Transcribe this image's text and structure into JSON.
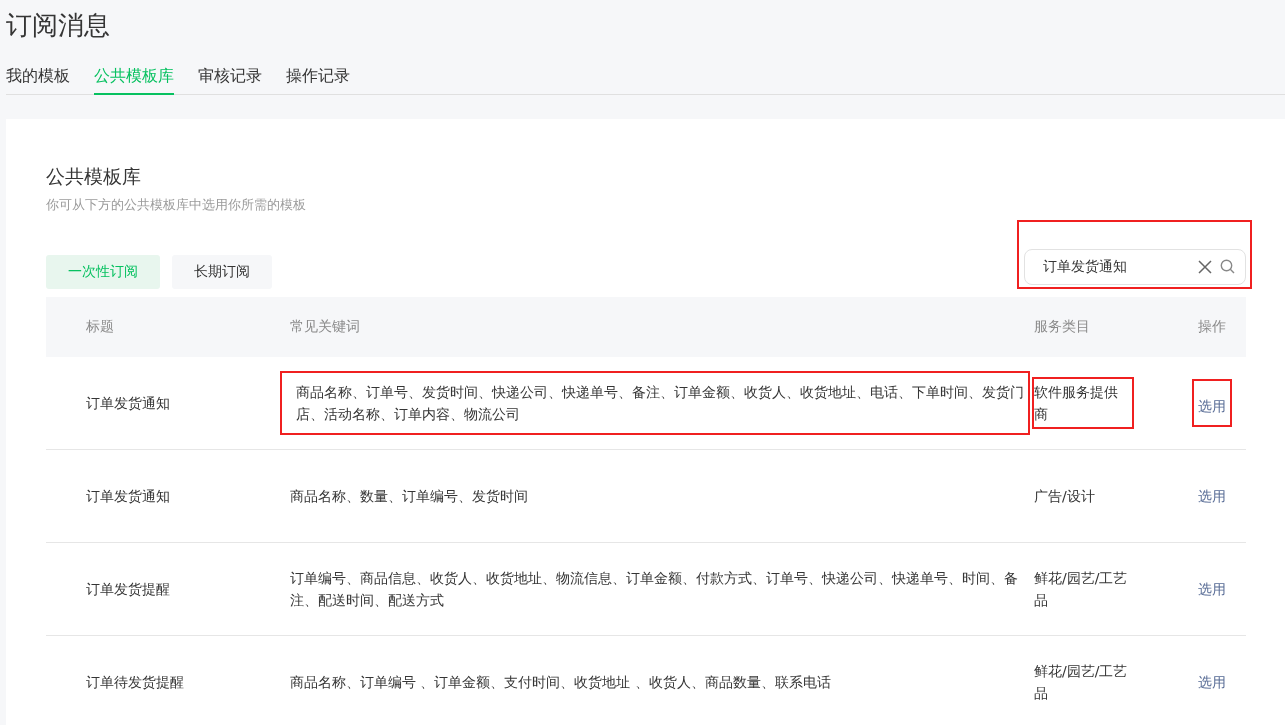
{
  "page": {
    "title": "订阅消息"
  },
  "tabs": [
    {
      "label": "我的模板",
      "selected": false
    },
    {
      "label": "公共模板库",
      "selected": true
    },
    {
      "label": "审核记录",
      "selected": false
    },
    {
      "label": "操作记录",
      "selected": false
    }
  ],
  "panel": {
    "heading": "公共模板库",
    "description": "你可从下方的公共模板库中选用你所需的模板"
  },
  "subscription_types": [
    {
      "label": "一次性订阅",
      "selected": true
    },
    {
      "label": "长期订阅",
      "selected": false
    }
  ],
  "search": {
    "value": "订单发货通知",
    "highlighted": true
  },
  "table": {
    "columns": [
      "标题",
      "常见关键词",
      "服务类目",
      "操作"
    ],
    "rows": [
      {
        "title": "订单发货通知",
        "keywords": "商品名称、订单号、发货时间、快递公司、快递单号、备注、订单金额、收货人、收货地址、电话、下单时间、发货门店、活动名称、订单内容、物流公司",
        "category": "软件服务提供商",
        "action": "选用",
        "highlighted": true
      },
      {
        "title": "订单发货通知",
        "keywords": "商品名称、数量、订单编号、发货时间",
        "category": "广告/设计",
        "action": "选用",
        "highlighted": false
      },
      {
        "title": "订单发货提醒",
        "keywords": "订单编号、商品信息、收货人、收货地址、物流信息、订单金额、付款方式、订单号、快递公司、快递单号、时间、备注、配送时间、配送方式",
        "category": "鲜花/园艺/工艺品",
        "action": "选用",
        "highlighted": false
      },
      {
        "title": "订单待发货提醒",
        "keywords": "商品名称、订单编号 、订单金额、支付时间、收货地址 、收货人、商品数量、联系电话",
        "category": "鲜花/园艺/工艺品",
        "action": "选用",
        "highlighted": false
      }
    ]
  }
}
